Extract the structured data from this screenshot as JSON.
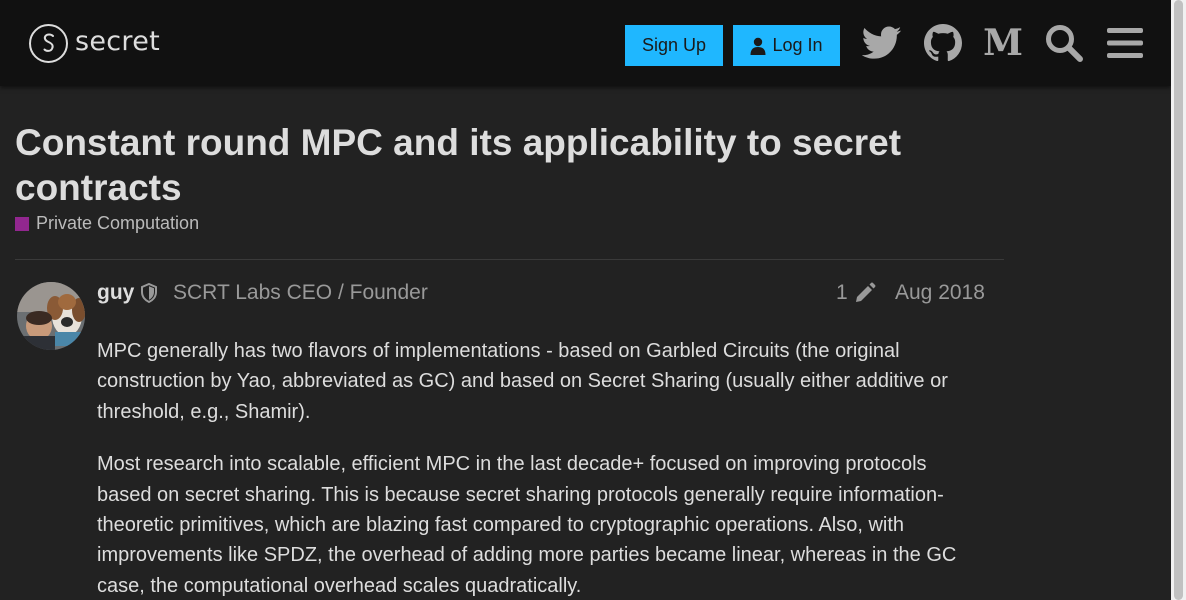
{
  "header": {
    "logo_text": "secret",
    "signup_label": "Sign Up",
    "login_label": "Log In",
    "icons": [
      "twitter-icon",
      "github-icon",
      "medium-icon",
      "search-icon",
      "hamburger-menu-icon"
    ],
    "medium_glyph": "M"
  },
  "topic": {
    "title": "Constant round MPC and its applicability to secret contracts",
    "category": "Private Computation",
    "category_color": "#92278f"
  },
  "post": {
    "username": "guy",
    "user_title": "SCRT Labs CEO / Founder",
    "edit_count": "1",
    "date": "Aug 2018",
    "paragraphs": [
      "MPC generally has two flavors of implementations - based on Garbled Circuits (the original construction by Yao, abbreviated as GC) and based on Secret Sharing (usually either additive or threshold, e.g., Shamir).",
      "Most research into scalable, efficient MPC in the last decade+ focused on improving protocols based on secret sharing. This is because secret sharing protocols generally require information-theoretic primitives, which are blazing fast compared to cryptographic operations. Also, with improvements like SPDZ, the overhead of adding more parties became linear, whereas in the GC case, the computational overhead scales quadratically."
    ]
  },
  "colors": {
    "accent": "#1fb7ff",
    "background": "#222222",
    "header": "#111111"
  }
}
